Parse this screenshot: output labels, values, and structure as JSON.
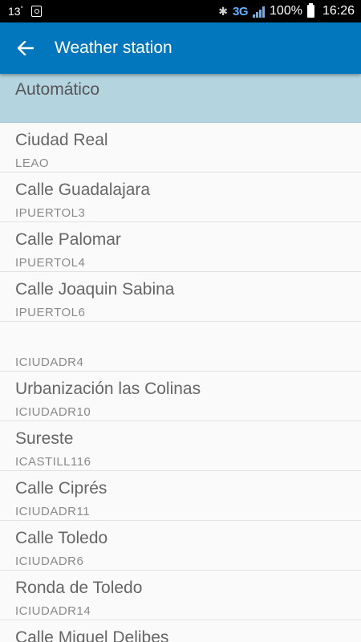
{
  "status_bar": {
    "temperature": "13",
    "degree": "°",
    "network": "3G",
    "battery": "100%",
    "time": "16:26"
  },
  "app_bar": {
    "title": "Weather station",
    "color": "#0277bd"
  },
  "selected_option": "Automático",
  "stations": [
    {
      "name": "Ciudad Real",
      "code": "LEAO"
    },
    {
      "name": "Calle Guadalajara",
      "code": "IPUERTOL3"
    },
    {
      "name": "Calle Palomar",
      "code": "IPUERTOL4"
    },
    {
      "name": "Calle Joaquin Sabina",
      "code": "IPUERTOL6"
    },
    {
      "name": "",
      "code": "ICIUDADR4"
    },
    {
      "name": "Urbanización las Colinas",
      "code": "ICIUDADR10"
    },
    {
      "name": "Sureste",
      "code": "ICASTILL116"
    },
    {
      "name": "Calle Ciprés",
      "code": "ICIUDADR11"
    },
    {
      "name": "Calle Toledo",
      "code": "ICIUDADR6"
    },
    {
      "name": "Ronda de Toledo",
      "code": "ICIUDADR14"
    },
    {
      "name": "Calle Miguel Delibes",
      "code": ""
    }
  ]
}
